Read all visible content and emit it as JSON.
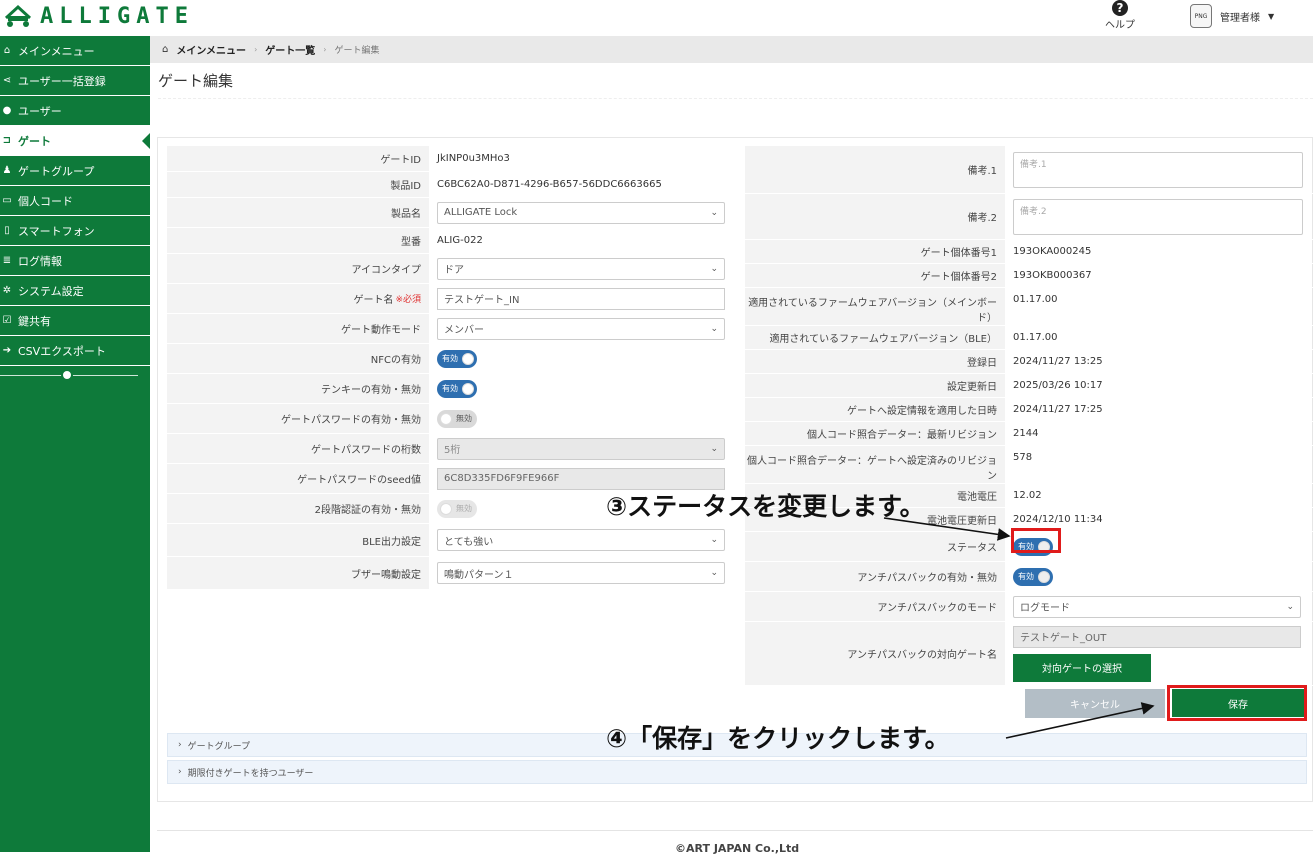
{
  "header": {
    "logo_text": "ALLIGATE",
    "help_label": "ヘルプ",
    "avatar_text": "PNG",
    "user_name": "管理者様"
  },
  "sidebar": {
    "items": [
      {
        "icon": "home-icon",
        "label": "メインメニュー",
        "active": false
      },
      {
        "icon": "share-icon",
        "label": "ユーザー一括登録",
        "active": false
      },
      {
        "icon": "user-icon",
        "label": "ユーザー",
        "active": false
      },
      {
        "icon": "gate-icon",
        "label": "ゲート",
        "active": true
      },
      {
        "icon": "users-icon",
        "label": "ゲートグループ",
        "active": false
      },
      {
        "icon": "card-icon",
        "label": "個人コード",
        "active": false
      },
      {
        "icon": "phone-icon",
        "label": "スマートフォン",
        "active": false
      },
      {
        "icon": "list-icon",
        "label": "ログ情報",
        "active": false
      },
      {
        "icon": "gear-icon",
        "label": "システム設定",
        "active": false
      },
      {
        "icon": "check-icon",
        "label": "鍵共有",
        "active": false
      },
      {
        "icon": "arrow-icon",
        "label": "CSVエクスポート",
        "active": false
      }
    ]
  },
  "breadcrumb": {
    "home": "メインメニュー",
    "list": "ゲート一覧",
    "current": "ゲート編集"
  },
  "page_title": "ゲート編集",
  "left": {
    "gate_id_label": "ゲートID",
    "gate_id_value": "JkINP0u3MHo3",
    "product_id_label": "製品ID",
    "product_id_value": "C6BC62A0-D871-4296-B657-56DDC6663665",
    "product_name_label": "製品名",
    "product_name_value": "ALLIGATE Lock",
    "model_label": "型番",
    "model_value": "ALIG-022",
    "icon_type_label": "アイコンタイプ",
    "icon_type_value": "ドア",
    "gate_name_label": "ゲート名",
    "required_label": "※必須",
    "gate_name_value": "テストゲート_IN",
    "gate_mode_label": "ゲート動作モード",
    "gate_mode_value": "メンバー",
    "nfc_label": "NFCの有効",
    "nfc_toggle": "有効",
    "tenkey_label": "テンキーの有効・無効",
    "tenkey_toggle": "有効",
    "gatepw_label": "ゲートパスワードの有効・無効",
    "gatepw_toggle": "無効",
    "gatepw_digits_label": "ゲートパスワードの桁数",
    "gatepw_digits_value": "5桁",
    "gatepw_seed_label": "ゲートパスワードのseed値",
    "gatepw_seed_value": "6C8D335FD6F9FE966F",
    "twostep_label": "2段階認証の有効・無効",
    "twostep_toggle": "無効",
    "ble_label": "BLE出力設定",
    "ble_value": "とても強い",
    "buzzer_label": "ブザー鳴動設定",
    "buzzer_value": "鳴動パターン１"
  },
  "right": {
    "note1_label": "備考.1",
    "note1_placeholder": "備考.1",
    "note2_label": "備考.2",
    "note2_placeholder": "備考.2",
    "serial1_label": "ゲート個体番号1",
    "serial1_value": "193OKA000245",
    "serial2_label": "ゲート個体番号2",
    "serial2_value": "193OKB000367",
    "fw_main_label": "適用されているファームウェアバージョン（メインボード）",
    "fw_main_value": "01.17.00",
    "fw_ble_label": "適用されているファームウェアバージョン（BLE）",
    "fw_ble_value": "01.17.00",
    "reg_date_label": "登録日",
    "reg_date_value": "2024/11/27 13:25",
    "upd_date_label": "設定更新日",
    "upd_date_value": "2025/03/26 10:17",
    "applied_label": "ゲートへ設定情報を適用した日時",
    "applied_value": "2024/11/27 17:25",
    "rev_latest_label": "個人コード照合データー：最新リビジョン",
    "rev_latest_value": "2144",
    "rev_applied_label": "個人コード照合データー：ゲートへ設定済みのリビジョン",
    "rev_applied_value": "578",
    "battery_label": "電池電圧",
    "battery_value": "12.02",
    "battery_upd_label": "電池電圧更新日",
    "battery_upd_value": "2024/12/10 11:34",
    "status_label": "ステータス",
    "status_toggle": "有効",
    "antipass_label": "アンチパスバックの有効・無効",
    "antipass_toggle": "有効",
    "antipass_mode_label": "アンチパスバックのモード",
    "antipass_mode_value": "ログモード",
    "antipass_gate_label": "アンチパスバックの対向ゲート名",
    "antipass_gate_value": "テストゲート_OUT",
    "select_gate_button": "対向ゲートの選択"
  },
  "actions": {
    "cancel": "キャンセル",
    "save": "保存"
  },
  "accordions": {
    "gate_group": "ゲートグループ",
    "limited_users": "期限付きゲートを持つユーザー"
  },
  "footer": "©ART JAPAN Co.,Ltd",
  "annotations": {
    "step3": "③ステータスを変更します。",
    "step4": "④「保存」をクリックします。"
  },
  "colors": {
    "brand_green": "#0e7a3a",
    "toggle_blue": "#2e6fb0",
    "highlight_red": "#e01b1b"
  }
}
